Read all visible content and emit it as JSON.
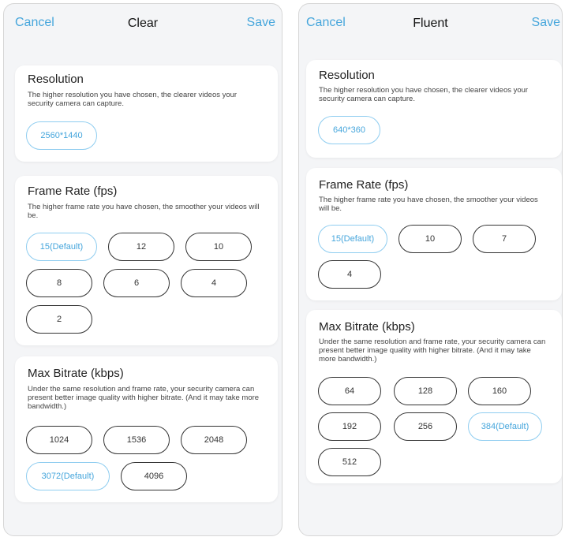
{
  "colors": {
    "accent": "#46a6dc",
    "selected_border": "#8fcdf0",
    "card_bg": "#ffffff",
    "page_bg": "#f4f5f7"
  },
  "left": {
    "nav": {
      "cancel": "Cancel",
      "title": "Clear",
      "save": "Save"
    },
    "resolution": {
      "title": "Resolution",
      "desc": "The higher resolution you have chosen, the clearer videos your security camera can capture.",
      "options": [
        "2560*1440"
      ],
      "selected": "2560*1440"
    },
    "frame_rate": {
      "title": "Frame Rate (fps)",
      "desc": "The higher frame rate you have chosen, the smoother your videos will be.",
      "options": [
        "15(Default)",
        "12",
        "10",
        "8",
        "6",
        "4",
        "2"
      ],
      "selected": "15(Default)"
    },
    "bitrate": {
      "title": "Max Bitrate (kbps)",
      "desc": "Under the same resolution and frame rate, your security camera can present better image quality with higher bitrate. (And it may take more bandwidth.)",
      "options": [
        "1024",
        "1536",
        "2048",
        "3072(Default)",
        "4096"
      ],
      "selected": "3072(Default)"
    }
  },
  "right": {
    "nav": {
      "cancel": "Cancel",
      "title": "Fluent",
      "save": "Save"
    },
    "resolution": {
      "title": "Resolution",
      "desc": "The higher resolution you have chosen, the clearer videos your security camera can capture.",
      "options": [
        "640*360"
      ],
      "selected": "640*360"
    },
    "frame_rate": {
      "title": "Frame Rate (fps)",
      "desc": "The higher frame rate you have chosen, the smoother your videos will be.",
      "options": [
        "15(Default)",
        "10",
        "7",
        "4"
      ],
      "selected": "15(Default)"
    },
    "bitrate": {
      "title": "Max Bitrate (kbps)",
      "desc": "Under the same resolution and frame rate, your security camera can present better image quality with higher bitrate. (And it may take more bandwidth.)",
      "options": [
        "64",
        "128",
        "160",
        "192",
        "256",
        "384(Default)",
        "512"
      ],
      "selected": "384(Default)"
    }
  }
}
